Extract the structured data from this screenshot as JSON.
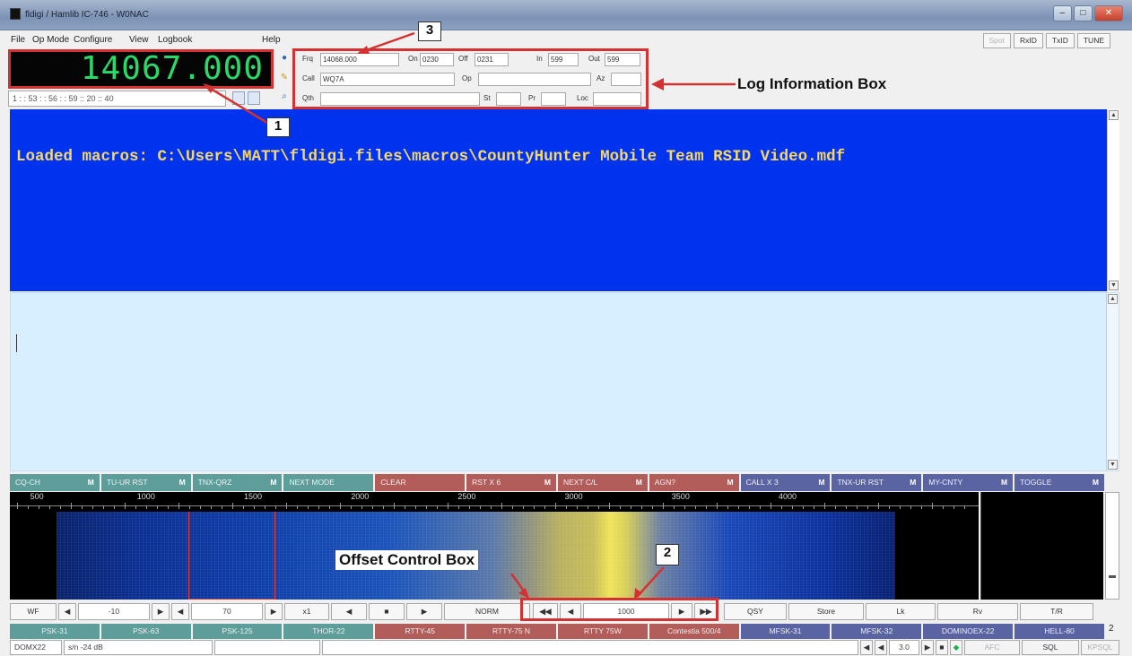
{
  "window": {
    "title": "fldigi / Hamlib IC-746 - W0NAC"
  },
  "menu": [
    "File",
    "Op Mode",
    "Configure",
    "View",
    "Logbook",
    "Help"
  ],
  "toolbar_right": [
    "Spot",
    "RxID",
    "TxID",
    "TUNE"
  ],
  "frequency": "14067.000",
  "clock": "1 : : 53 : : 56 : : 59 :: 20 :: 40",
  "log": {
    "labels": {
      "frq": "Frq",
      "on": "On",
      "off": "Off",
      "in": "In",
      "out": "Out",
      "call": "Call",
      "op": "Op",
      "az": "Az",
      "qth": "Qth",
      "st": "St",
      "pr": "Pr",
      "loc": "Loc"
    },
    "frq": "14068.000",
    "on": "0230",
    "off": "0231",
    "in": "599",
    "out": "599",
    "call": "WQ7A",
    "op": "",
    "az": "",
    "qth": "",
    "st": "",
    "pr": "",
    "loc": ""
  },
  "rx_text": "Loaded macros: C:\\Users\\MATT\\fldigi.files\\macros\\CountyHunter Mobile Team RSID Video.mdf",
  "macros": [
    {
      "label": "CQ-CH",
      "mark": "M",
      "color": "teal"
    },
    {
      "label": "TU-UR RST",
      "mark": "M",
      "color": "teal"
    },
    {
      "label": "TNX-QRZ",
      "mark": "M",
      "color": "teal"
    },
    {
      "label": "NEXT MODE",
      "mark": "",
      "color": "teal"
    },
    {
      "label": "CLEAR",
      "mark": "",
      "color": "red"
    },
    {
      "label": "RST X 6",
      "mark": "M",
      "color": "red"
    },
    {
      "label": "NEXT C/L",
      "mark": "M",
      "color": "red"
    },
    {
      "label": "AGN?",
      "mark": "M",
      "color": "red"
    },
    {
      "label": "CALL X 3",
      "mark": "M",
      "color": "blue"
    },
    {
      "label": "TNX-UR RST",
      "mark": "M",
      "color": "blue"
    },
    {
      "label": "MY-CNTY",
      "mark": "M",
      "color": "blue"
    },
    {
      "label": "TOGGLE",
      "mark": "M",
      "color": "blue"
    }
  ],
  "scale_ticks": [
    "500",
    "1000",
    "1500",
    "2000",
    "2500",
    "3000",
    "3500",
    "4000"
  ],
  "controls": {
    "wf": "WF",
    "level1": "-10",
    "level2": "70",
    "zoom": "x1",
    "norm": "NORM",
    "offset": "1000",
    "qsy": "QSY",
    "store": "Store",
    "lk": "Lk",
    "rv": "Rv",
    "tr": "T/R"
  },
  "modes": [
    "PSK-31",
    "PSK-63",
    "PSK-125",
    "THOR-22",
    "RTTY-45",
    "RTTY-75 N",
    "RTTY 75W",
    "Contestia 500/4",
    "MFSK-31",
    "MFSK-32",
    "DOMINOEX-22",
    "HELL-80"
  ],
  "mode_count": "2",
  "status": {
    "mode": "DOMX22",
    "sn": "s/n -24 dB",
    "value": "3.0",
    "afc": "AFC",
    "sql": "SQL",
    "kpsql": "KPSQL"
  },
  "annotations": {
    "n1": "1",
    "n2": "2",
    "n3": "3",
    "log_box": "Log Information Box",
    "offset_box": "Offset Control Box"
  }
}
